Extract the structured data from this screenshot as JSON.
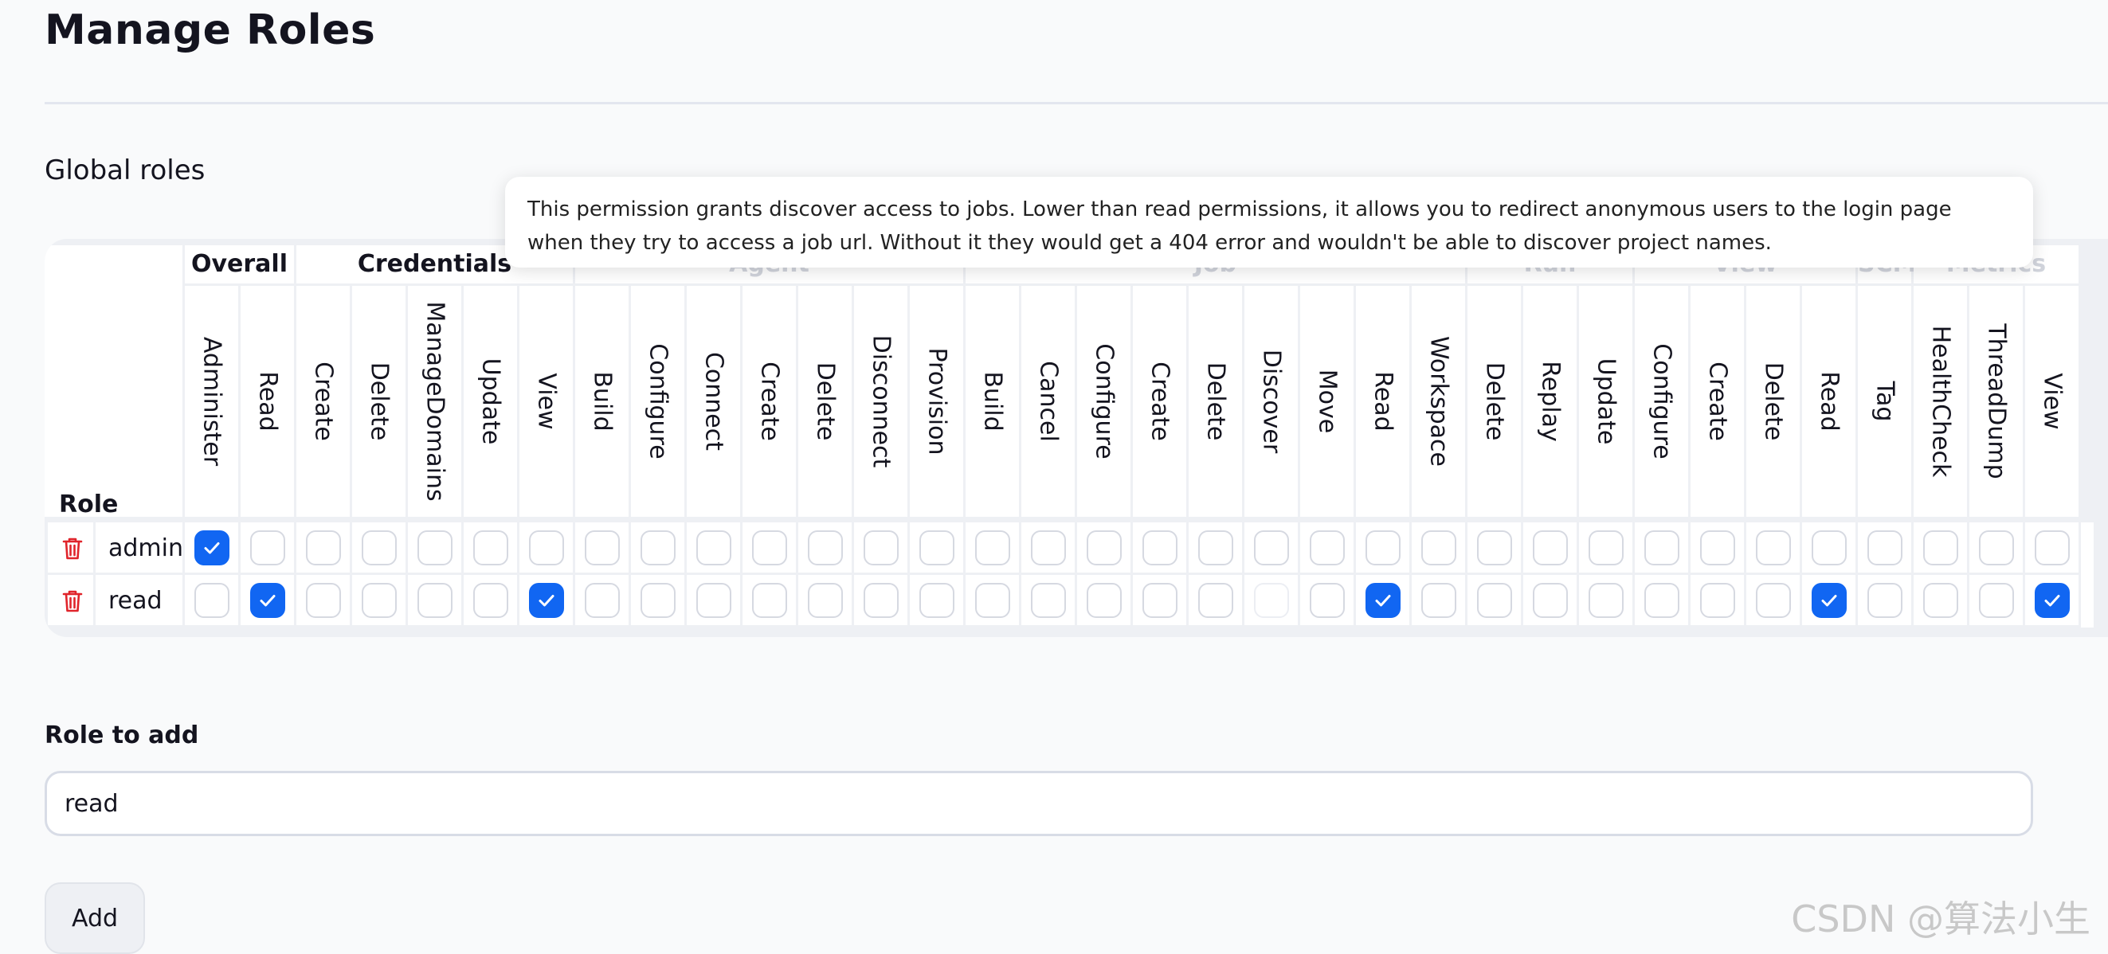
{
  "page": {
    "title": "Manage Roles",
    "section_title": "Global roles",
    "role_header": "Role",
    "tooltip": "This permission grants discover access to jobs. Lower than read permissions, it allows you to redirect anonymous users to the login page when they try to access a job url. Without it they would get a 404 error and wouldn't be able to discover project names."
  },
  "groups": [
    {
      "label": "Overall",
      "span": 2
    },
    {
      "label": "Credentials",
      "span": 5
    },
    {
      "label": "Agent",
      "span": 7
    },
    {
      "label": "Job",
      "span": 9
    },
    {
      "label": "Run",
      "span": 3
    },
    {
      "label": "View",
      "span": 4
    },
    {
      "label": "SCM",
      "span": 1
    },
    {
      "label": "Metrics",
      "span": 3
    }
  ],
  "permissions": [
    "Administer",
    "Read",
    "Create",
    "Delete",
    "ManageDomains",
    "Update",
    "View",
    "Build",
    "Configure",
    "Connect",
    "Create",
    "Delete",
    "Disconnect",
    "Provision",
    "Build",
    "Cancel",
    "Configure",
    "Create",
    "Delete",
    "Discover",
    "Move",
    "Read",
    "Workspace",
    "Delete",
    "Replay",
    "Update",
    "Configure",
    "Create",
    "Delete",
    "Read",
    "Tag",
    "HealthCheck",
    "ThreadDump",
    "View"
  ],
  "roles": [
    {
      "name": "admin",
      "checked": [
        0
      ]
    },
    {
      "name": "read",
      "checked": [
        1,
        6,
        21,
        29,
        33
      ],
      "disabled": [
        19
      ]
    }
  ],
  "add_role": {
    "label": "Role to add",
    "value": "read",
    "button": "Add"
  },
  "colors": {
    "accent": "#1166f2",
    "delete_icon": "#e0242b",
    "border": "#d6d9e1"
  },
  "icons": {
    "delete": "trash-icon",
    "check": "check-icon"
  },
  "watermark": "CSDN @算法小生"
}
